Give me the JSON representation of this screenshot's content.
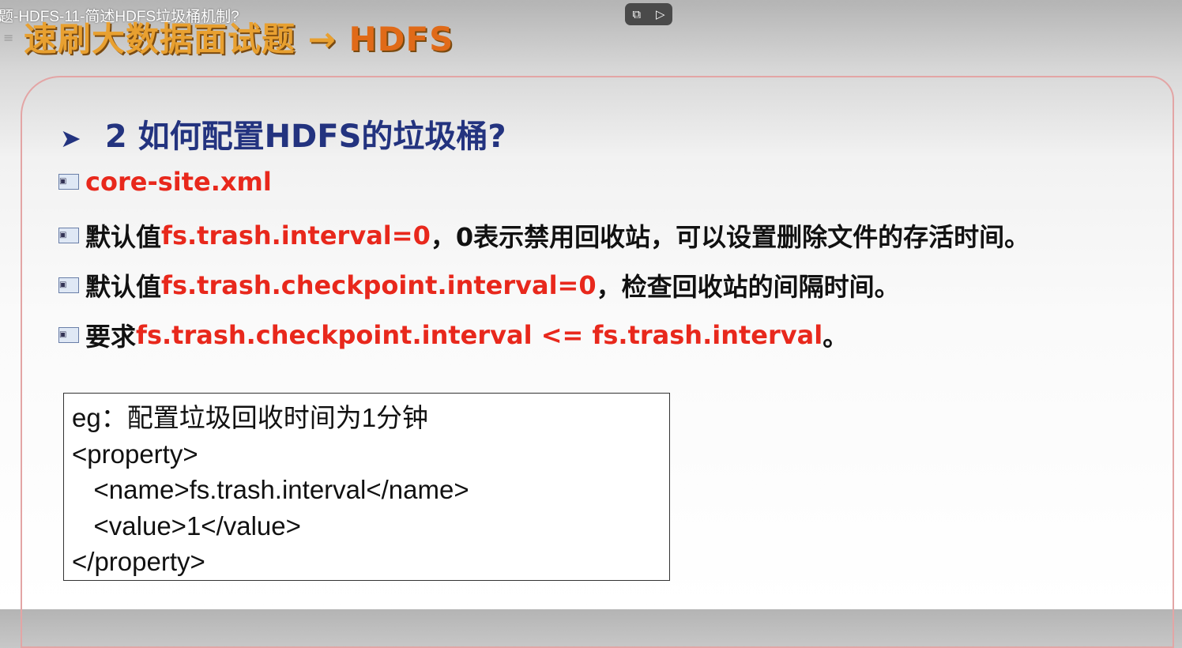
{
  "video_title": "题-HDFS-11-简述HDFS垃圾桶机制?",
  "banner": {
    "text": "速刷大数据面试题 → ",
    "hdfs": "HDFS"
  },
  "heading": "2 如何配置HDFS的垃圾桶?",
  "bullets": [
    {
      "pre": "",
      "red": "core-site.xml",
      "post": ""
    },
    {
      "pre": "默认值",
      "red": "fs.trash.interval=0",
      "post": "，0表示禁用回收站，可以设置删除文件的存活时间。"
    },
    {
      "pre": "默认值",
      "red": "fs.trash.checkpoint.interval=0",
      "post": "，检查回收站的间隔时间。"
    },
    {
      "pre": "要求",
      "red": "fs.trash.checkpoint.interval <= fs.trash.interval",
      "post": "。"
    }
  ],
  "example": [
    "eg：配置垃圾回收时间为1分钟",
    "<property>",
    "   <name>fs.trash.interval</name>",
    "   <value>1</value>",
    "</property>"
  ]
}
